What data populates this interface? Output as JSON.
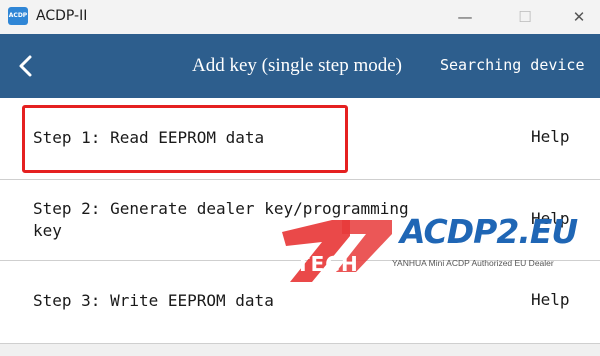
{
  "window": {
    "app_logo_text": "ACDP",
    "title": "ACDP-II",
    "minimize_glyph": "—",
    "maximize_glyph": "☐",
    "close_glyph": "✕"
  },
  "header": {
    "back_icon": "chevron-left-icon",
    "title": "Add key (single step mode)",
    "status": "Searching device"
  },
  "steps": [
    {
      "label": "Step 1: Read EEPROM data",
      "help": "Help",
      "highlighted": true
    },
    {
      "label": "Step 2: Generate dealer key/programming\nkey",
      "help": "Help",
      "highlighted": false
    },
    {
      "label": "Step 3: Write EEPROM data",
      "help": "Help",
      "highlighted": false
    }
  ],
  "watermark": {
    "logo_text": "TECH",
    "brand": "ACDP2.EU",
    "tagline": "YANHUA Mini ACDP Authorized EU Dealer"
  },
  "colors": {
    "header_bg": "#2d5e8d",
    "highlight_border": "#e52020",
    "watermark_logo": "#e83a3a",
    "watermark_brand": "#1f66b5"
  }
}
